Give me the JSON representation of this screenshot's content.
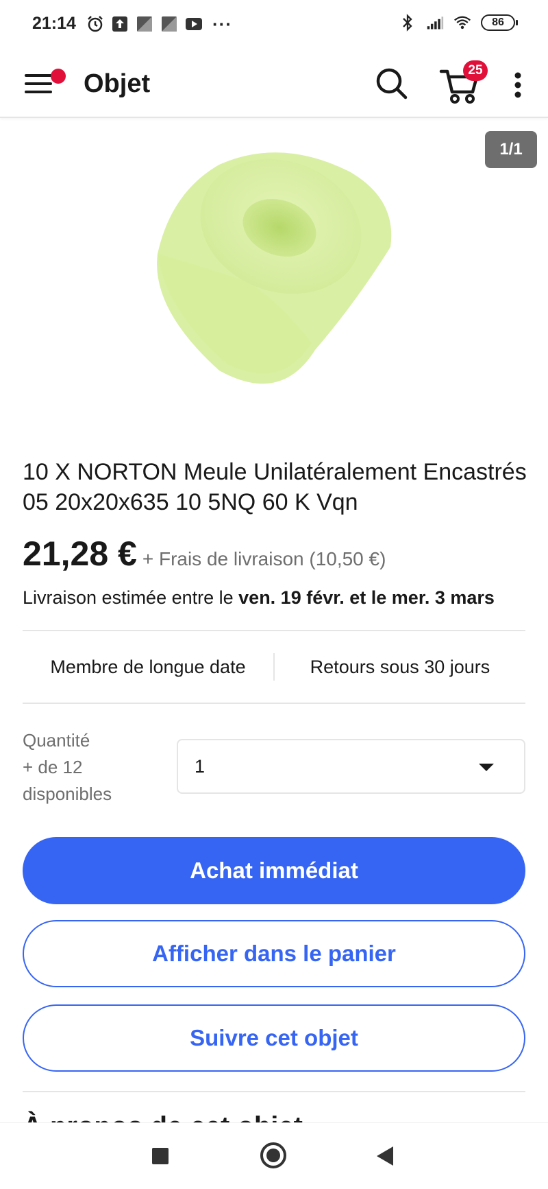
{
  "status_bar": {
    "time": "21:14",
    "battery": "86",
    "icons_left": [
      "alarm-icon",
      "upload-icon",
      "app-icon",
      "app-icon",
      "youtube-icon",
      "more-dots"
    ],
    "icons_right": [
      "bluetooth-icon",
      "signal-icon",
      "wifi-icon",
      "battery-icon"
    ],
    "dots": "···"
  },
  "app_bar": {
    "title": "Objet",
    "cart_count": "25",
    "menu_notification_color": "#e0103a"
  },
  "image": {
    "counter": "1/1",
    "subject": "green foam cylinder grinding wheel"
  },
  "product": {
    "title": "10 X NORTON Meule Unilatéralement Encastrés 05 20x20x635 10 5NQ 60 K Vqn",
    "price": "21,28 €",
    "shipping": "+ Frais de livraison (10,50 €)",
    "delivery_prefix": "Livraison estimée entre le ",
    "delivery_dates": "ven. 19 févr. et le mer. 3 mars"
  },
  "badges": [
    "Membre de longue date",
    "Retours sous 30 jours"
  ],
  "quantity": {
    "label_line1": "Quantité",
    "label_line2": "+ de 12",
    "label_line3": "disponibles",
    "selected": "1"
  },
  "actions": {
    "buy_now": "Achat immédiat",
    "view_in_cart": "Afficher dans le panier",
    "watch": "Suivre cet objet"
  },
  "section_peek": "À propos de cet objet",
  "colors": {
    "primary": "#3665f3",
    "badge_red": "#e0103a",
    "text": "#191919",
    "muted": "#6e6e6e"
  }
}
